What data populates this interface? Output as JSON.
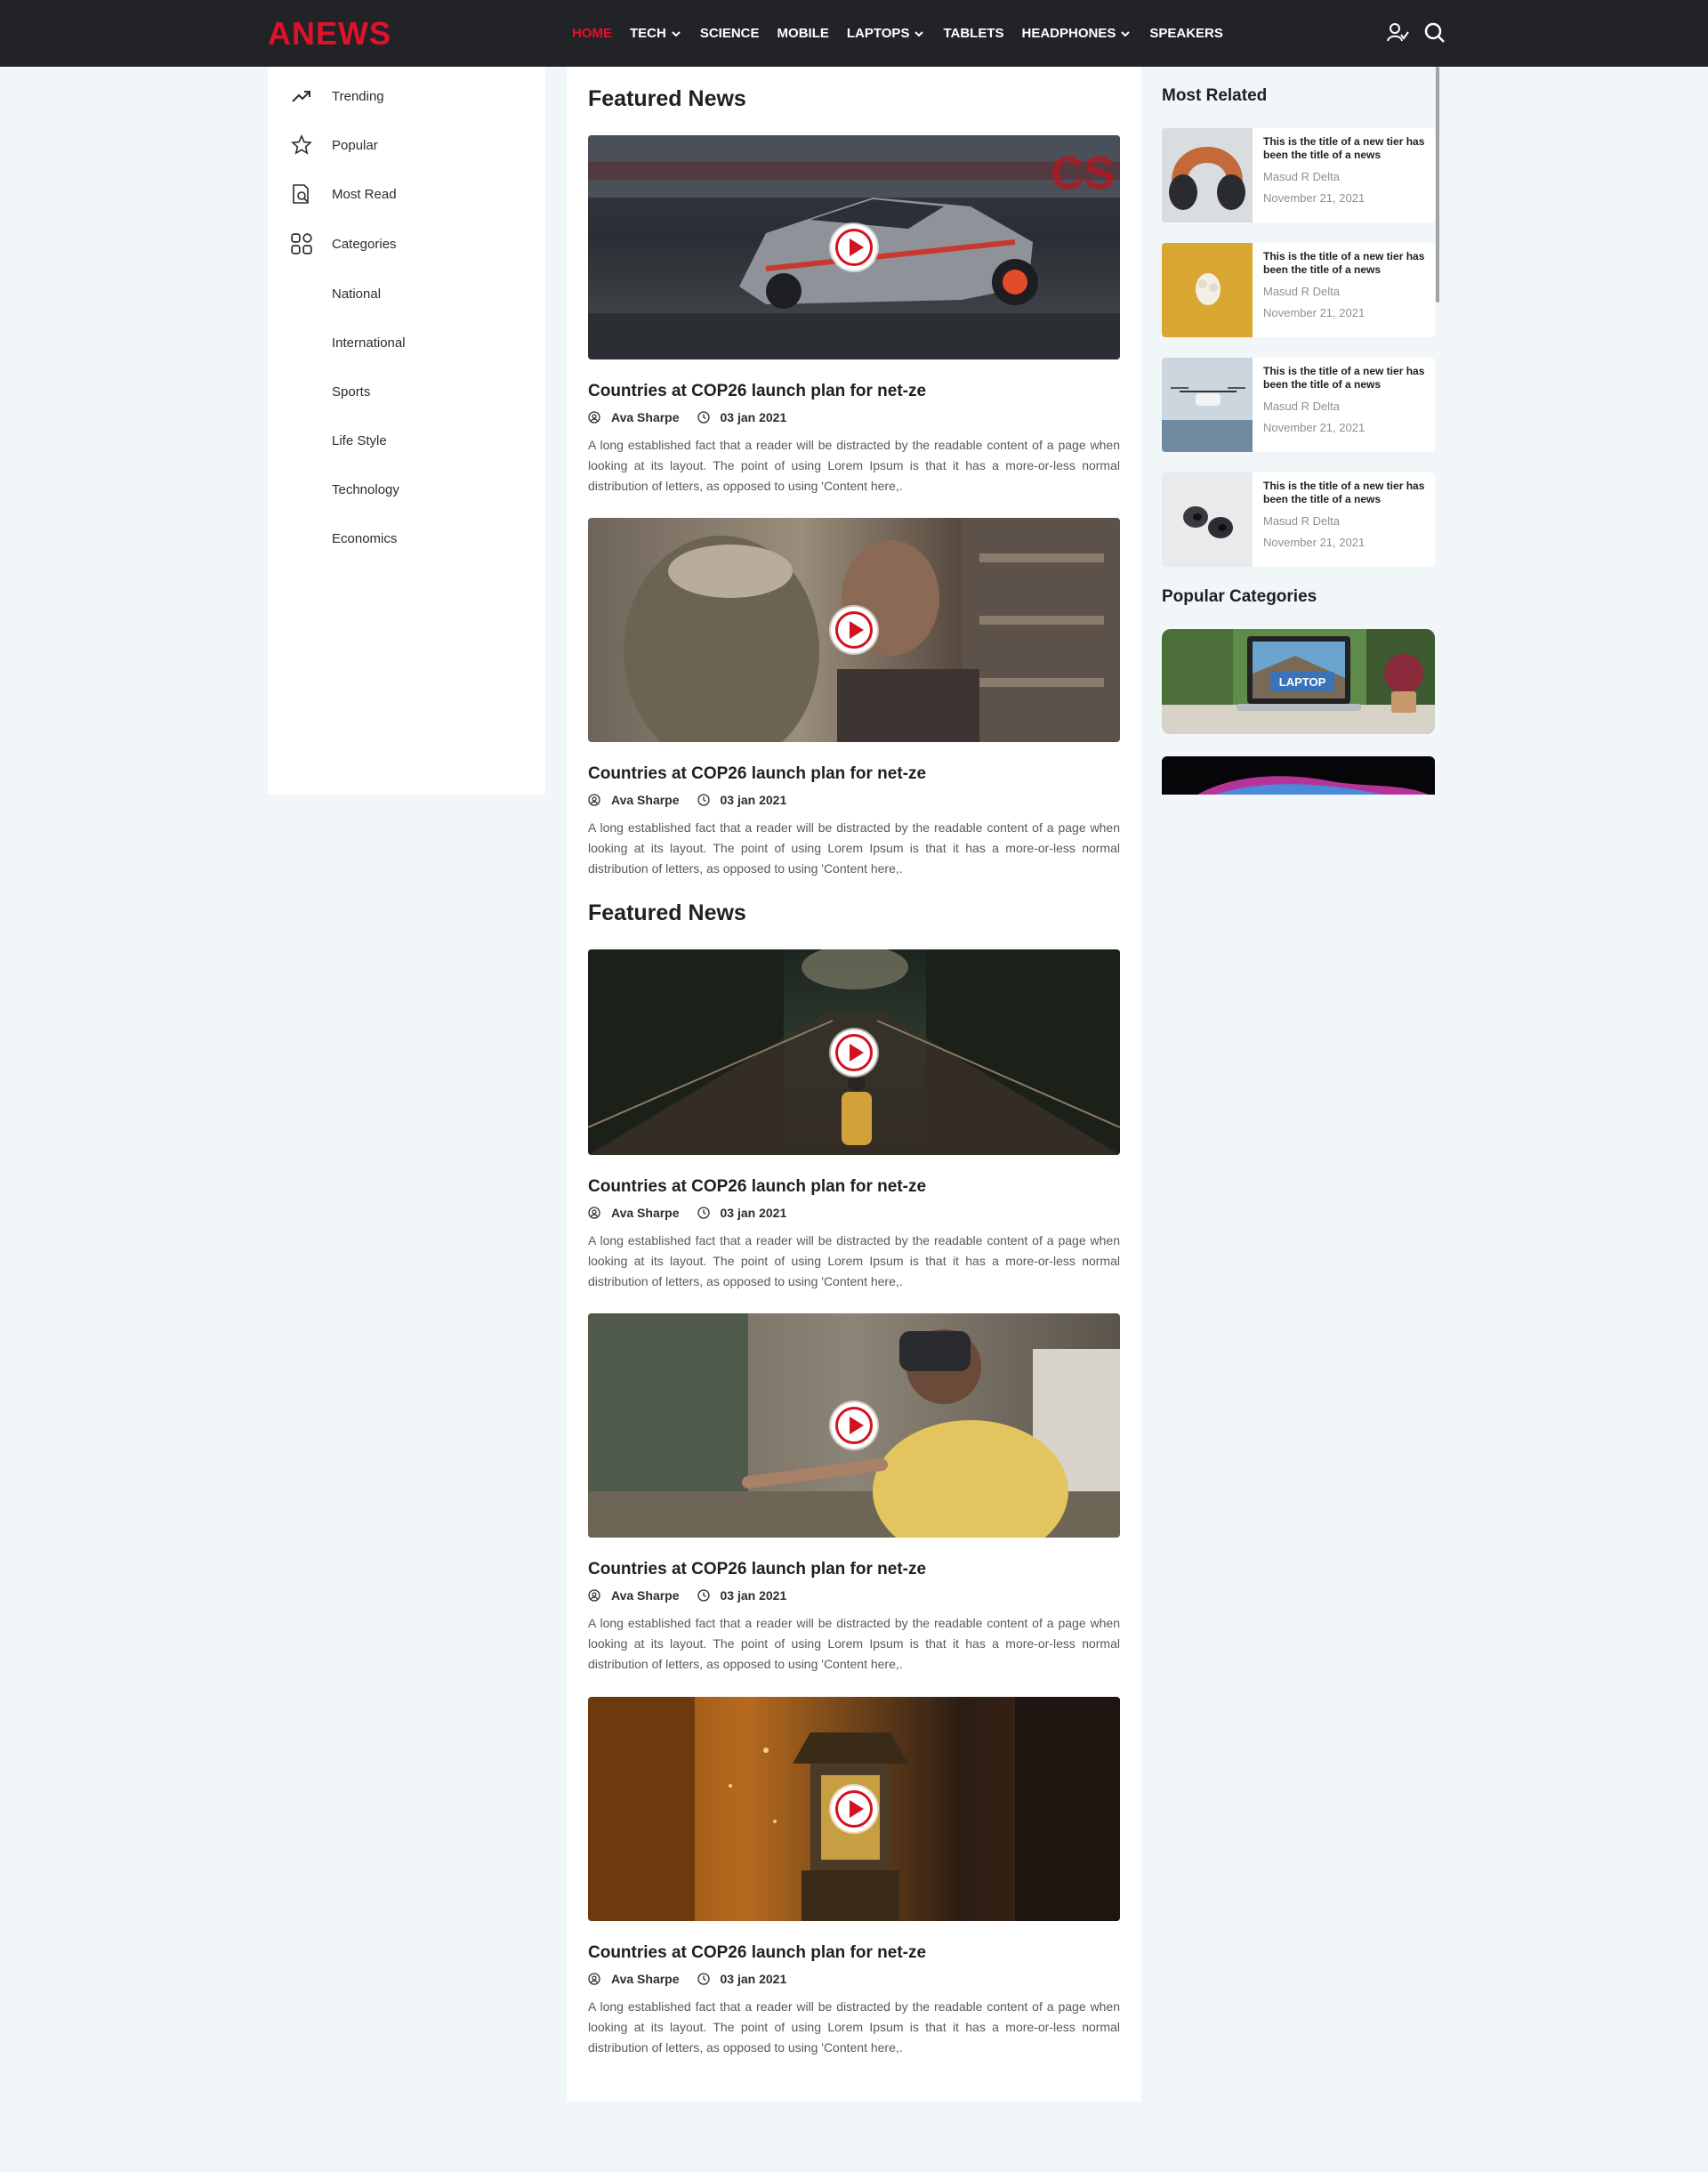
{
  "header": {
    "logo": "ANEWS",
    "nav": [
      {
        "label": "HOME",
        "active": true,
        "dropdown": false
      },
      {
        "label": "TECH",
        "active": false,
        "dropdown": true
      },
      {
        "label": "SCIENCE",
        "active": false,
        "dropdown": false
      },
      {
        "label": "MOBILE",
        "active": false,
        "dropdown": false
      },
      {
        "label": "LAPTOPS",
        "active": false,
        "dropdown": true
      },
      {
        "label": "TABLETS",
        "active": false,
        "dropdown": false
      },
      {
        "label": "HEADPHONES",
        "active": false,
        "dropdown": true
      },
      {
        "label": "SPEAKERS",
        "active": false,
        "dropdown": false
      }
    ],
    "icons": [
      "user-icon",
      "search-icon"
    ]
  },
  "sidebar": {
    "items": [
      {
        "label": "Trending",
        "icon": "trending-icon"
      },
      {
        "label": "Popular",
        "icon": "star-icon"
      },
      {
        "label": "Most Read",
        "icon": "document-search-icon"
      },
      {
        "label": "Categories",
        "icon": "grid-icon"
      },
      {
        "label": "National",
        "icon": ""
      },
      {
        "label": "International",
        "icon": ""
      },
      {
        "label": "Sports",
        "icon": ""
      },
      {
        "label": "Life Style",
        "icon": ""
      },
      {
        "label": "Technology",
        "icon": ""
      },
      {
        "label": "Economics",
        "icon": ""
      }
    ]
  },
  "main": {
    "sections": [
      {
        "title": "Featured News",
        "articles": [
          {
            "title": "Countries at COP26 launch plan for net-ze",
            "author": "Ava Sharpe",
            "date": "03 jan 2021",
            "excerpt": "A long established fact that a reader will be distracted by the readable content of a page when looking at its layout. The point of using Lorem Ipsum is that it has a more-or-less normal distribution of letters, as opposed to using 'Content here,.",
            "image": "drift-car"
          },
          {
            "title": "Countries at COP26 launch plan for net-ze",
            "author": "Ava Sharpe",
            "date": "03 jan 2021",
            "excerpt": "A long established fact that a reader will be distracted by the readable content of a page when looking at its layout. The point of using Lorem Ipsum is that it has a more-or-less normal distribution of letters, as opposed to using 'Content here,.",
            "image": "friends-laptop"
          }
        ]
      },
      {
        "title": "Featured News",
        "articles": [
          {
            "title": "Countries at COP26 launch plan for net-ze",
            "author": "Ava Sharpe",
            "date": "03 jan 2021",
            "excerpt": "A long established fact that a reader will be distracted by the readable content of a page when looking at its layout. The point of using Lorem Ipsum is that it has a more-or-less normal distribution of letters, as opposed to using 'Content here,.",
            "image": "forest-bridge"
          },
          {
            "title": "Countries at COP26 launch plan for net-ze",
            "author": "Ava Sharpe",
            "date": "03 jan 2021",
            "excerpt": "A long established fact that a reader will be distracted by the readable content of a page when looking at its layout. The point of using Lorem Ipsum is that it has a more-or-less normal distribution of letters, as opposed to using 'Content here,.",
            "image": "vr-headset"
          },
          {
            "title": "Countries at COP26 launch plan for net-ze",
            "author": "Ava Sharpe",
            "date": "03 jan 2021",
            "excerpt": "A long established fact that a reader will be distracted by the readable content of a page when looking at its layout. The point of using Lorem Ipsum is that it has a more-or-less normal distribution of letters, as opposed to using 'Content here,.",
            "image": "lantern"
          }
        ]
      }
    ]
  },
  "right": {
    "related_title": "Most Related",
    "related": [
      {
        "title": "This is the title of a new tier has been the title of a news",
        "author": "Masud R Delta",
        "date": "November 21, 2021",
        "image": "headphones"
      },
      {
        "title": "This is the title of a new tier has been the title of a news",
        "author": "Masud R Delta",
        "date": "November 21, 2021",
        "image": "earbuds-yellow"
      },
      {
        "title": "This is the title of a new tier has been the title of a news",
        "author": "Masud R Delta",
        "date": "November 21, 2021",
        "image": "drone"
      },
      {
        "title": "This is the title of a new tier has been the title of a news",
        "author": "Masud R Delta",
        "date": "November 21, 2021",
        "image": "earbuds-white"
      }
    ],
    "categories_title": "Popular Categories",
    "categories": [
      {
        "label": "LAPTOP"
      },
      {
        "label": ""
      }
    ]
  },
  "colors": {
    "accent": "#e0122a",
    "header_bg": "#222327",
    "page_bg": "#f1f6f9"
  }
}
